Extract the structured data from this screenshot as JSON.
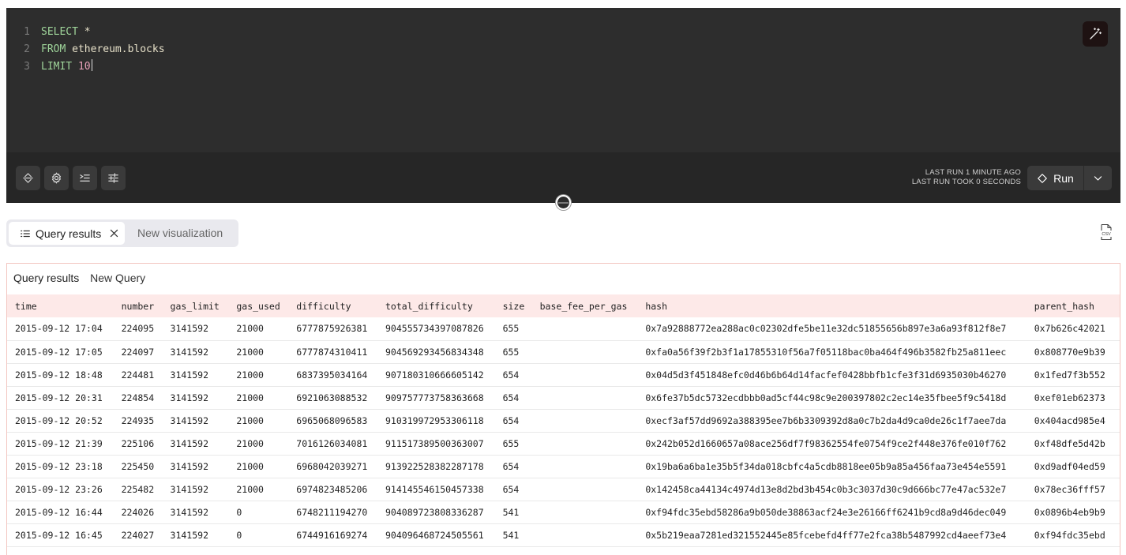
{
  "editor": {
    "lines": [
      {
        "num": "1",
        "parts": [
          {
            "t": "SELECT",
            "c": "kw"
          },
          {
            "t": " *",
            "c": "ident"
          }
        ]
      },
      {
        "num": "2",
        "parts": [
          {
            "t": "FROM",
            "c": "kw"
          },
          {
            "t": " ethereum.blocks",
            "c": "ident"
          }
        ]
      },
      {
        "num": "3",
        "parts": [
          {
            "t": "LIMIT",
            "c": "kw"
          },
          {
            "t": " 10",
            "c": "num"
          }
        ]
      }
    ]
  },
  "toolbar": {
    "last_run": "LAST RUN 1 MINUTE AGO",
    "last_took": "LAST RUN TOOK 0 SECONDS",
    "run_label": "Run"
  },
  "tabs": {
    "active": "Query results",
    "inactive": "New visualization"
  },
  "results": {
    "title": "Query results",
    "subtitle": "New Query",
    "columns": [
      "time",
      "number",
      "gas_limit",
      "gas_used",
      "difficulty",
      "total_difficulty",
      "size",
      "base_fee_per_gas",
      "hash",
      "parent_hash"
    ],
    "rows": [
      [
        "2015-09-12 17:04",
        "224095",
        "3141592",
        "21000",
        "6777875926381",
        "904555734397087826",
        "655",
        "",
        "0x7a92888772ea288ac0c02302dfe5be11e32dc51855656b897e3a6a93f812f8e7",
        "0x7b626c42021"
      ],
      [
        "2015-09-12 17:05",
        "224097",
        "3141592",
        "21000",
        "6777874310411",
        "904569293456834348",
        "655",
        "",
        "0xfa0a56f39f2b3f1a17855310f56a7f05118bac0ba464f496b3582fb25a811eec",
        "0x808770e9b39"
      ],
      [
        "2015-09-12 18:48",
        "224481",
        "3141592",
        "21000",
        "6837395034164",
        "907180310666605142",
        "654",
        "",
        "0x04d5d3f451848efc0d46b6b64d14facfef0428bbfb1cfe3f31d6935030b46270",
        "0x1fed7f3b552"
      ],
      [
        "2015-09-12 20:31",
        "224854",
        "3141592",
        "21000",
        "6921063088532",
        "909757773758363668",
        "654",
        "",
        "0x6fe37b5dc5732ecdbbb0ad5cf44c98c9e200397802c2ec14e35fbee5f9c5418d",
        "0xef01eb62373"
      ],
      [
        "2015-09-12 20:52",
        "224935",
        "3141592",
        "21000",
        "6965068096583",
        "910319972953306118",
        "654",
        "",
        "0xecf3af57dd9692a388395ee7b6b3309392d8a0c7b2da4d9ca0de26c1f7aee7da",
        "0x404acd985e4"
      ],
      [
        "2015-09-12 21:39",
        "225106",
        "3141592",
        "21000",
        "7016126034081",
        "911517389500363007",
        "655",
        "",
        "0x242b052d1660657a08ace256df7f98362554fe0754f9ce2f448e376fe010f762",
        "0xf48dfe5d42b"
      ],
      [
        "2015-09-12 23:18",
        "225450",
        "3141592",
        "21000",
        "6968042039271",
        "913922528382287178",
        "654",
        "",
        "0x19ba6a6ba1e35b5f34da018cbfc4a5cdb8818ee05b9a85a456faa73e454e5591",
        "0xd9adf04ed59"
      ],
      [
        "2015-09-12 23:26",
        "225482",
        "3141592",
        "21000",
        "6974823485206",
        "914145546150457338",
        "654",
        "",
        "0x142458ca44134c4974d13e8d2bd3b454c0b3c3037d30c9d666bc77e47ac532e7",
        "0x78ec36fff57"
      ],
      [
        "2015-09-12 16:44",
        "224026",
        "3141592",
        "0",
        "6748211194270",
        "904089723808336287",
        "541",
        "",
        "0xf94fdc35ebd58286a9b050de38863acf24e3e26166ff6241b9cd8a9d46dec049",
        "0x0896b4eb9b9"
      ],
      [
        "2015-09-12 16:45",
        "224027",
        "3141592",
        "0",
        "6744916169274",
        "904096468724505561",
        "541",
        "",
        "0x5b219eaa7281ed321552445e85fcebefd4ff77e2fca38b5487992cd4aeef73e4",
        "0xf94fdc35ebd"
      ]
    ]
  }
}
